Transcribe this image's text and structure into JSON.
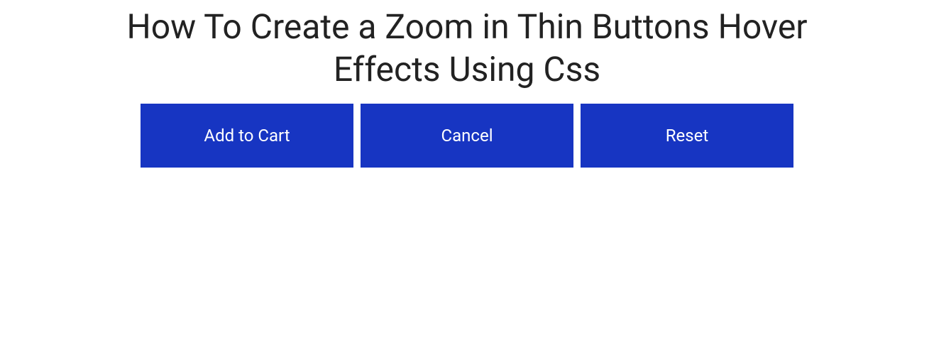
{
  "title": "How To Create a Zoom in Thin Buttons Hover Effects Using Css",
  "buttons": {
    "addToCart": "Add to Cart",
    "cancel": "Cancel",
    "reset": "Reset"
  },
  "colors": {
    "buttonBg": "#1735c2",
    "buttonText": "#ffffff",
    "titleText": "#222222"
  }
}
